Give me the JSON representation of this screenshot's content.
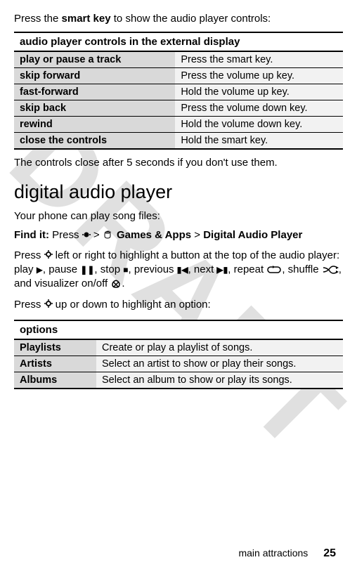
{
  "watermark": "DRAFT",
  "intro": {
    "prefix": "Press the ",
    "bold": "smart key",
    "suffix": " to show the audio player controls:"
  },
  "controls_table": {
    "header": "audio player controls in the external display",
    "rows": [
      {
        "label": "play or pause a track",
        "desc": "Press the smart key."
      },
      {
        "label": "skip forward",
        "desc": "Press the volume up key."
      },
      {
        "label": "fast-forward",
        "desc": "Hold the volume up key."
      },
      {
        "label": "skip back",
        "desc": "Press the volume down key."
      },
      {
        "label": "rewind",
        "desc": "Hold the volume down key."
      },
      {
        "label": "close the controls",
        "desc": "Hold the smart key."
      }
    ]
  },
  "note": "The controls close after 5 seconds if you don't use them.",
  "heading": "digital audio player",
  "subline": "Your phone can play song files:",
  "find_it": {
    "label": "Find it: ",
    "press": "Press ",
    "sep": " > ",
    "games": " Games & Apps",
    "player": "Digital Audio Player"
  },
  "nav_para": {
    "p1": "Press ",
    "p2": " left or right to highlight a button at the top of the audio player: play ",
    "p3": ", pause ",
    "p4": ", stop ",
    "p5": ", previous ",
    "p6": ", next ",
    "p7": ", repeat ",
    "p8": ", shuffle ",
    "p9": ", and visualizer on/off ",
    "p10": "."
  },
  "nav_para2": {
    "p1": "Press ",
    "p2": " up or down to highlight an option:"
  },
  "options_table": {
    "header": "options",
    "rows": [
      {
        "label": "Playlists",
        "desc": "Create or play a playlist of songs."
      },
      {
        "label": "Artists",
        "desc": "Select an artist to show or play their songs."
      },
      {
        "label": "Albums",
        "desc": "Select an album to show or play its songs."
      }
    ]
  },
  "footer": {
    "section": "main attractions",
    "page": "25"
  }
}
